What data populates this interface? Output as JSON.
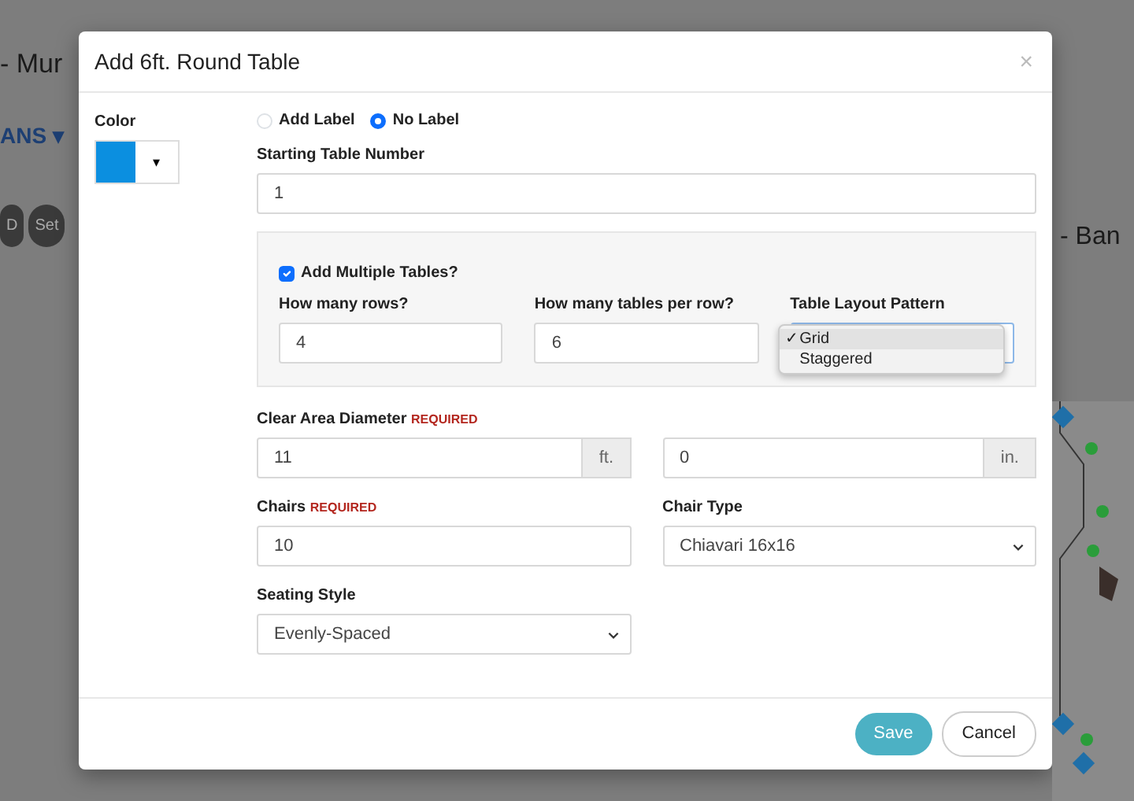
{
  "background": {
    "page_title": "- Mur",
    "menu": {
      "label": "ANS",
      "caret": "▾"
    },
    "pills": [
      "D",
      "Set"
    ],
    "heading_right": "- Ban"
  },
  "modal": {
    "title": "Add 6ft. Round Table",
    "close": "×",
    "color": {
      "label": "Color",
      "color": "#0b8fe0",
      "caret": "▾"
    },
    "label_options": [
      {
        "label": "Add Label",
        "selected": false
      },
      {
        "label": "No Label",
        "selected": true
      }
    ],
    "starting_table_number": {
      "label": "Starting Table Number",
      "value": "1"
    },
    "multiple": {
      "label": "Add Multiple Tables?",
      "checked": true,
      "rows": {
        "label": "How many rows?",
        "value": "4"
      },
      "per_row": {
        "label": "How many tables per row?",
        "value": "6"
      },
      "layout": {
        "label": "Table Layout Pattern",
        "expanded": true,
        "check_mark": "✓",
        "options": [
          {
            "label": "Grid",
            "selected": true
          },
          {
            "label": "Staggered",
            "selected": false
          }
        ]
      }
    },
    "clear_area": {
      "label": "Clear Area Diameter",
      "required": "REQUIRED",
      "feet": {
        "value": "11",
        "unit": "ft."
      },
      "inches": {
        "value": "0",
        "unit": "in."
      }
    },
    "chairs": {
      "label": "Chairs",
      "required": "REQUIRED",
      "value": "10"
    },
    "chair_type": {
      "label": "Chair Type",
      "value": "Chiavari 16x16"
    },
    "seating_style": {
      "label": "Seating Style",
      "value": "Evenly-Spaced"
    },
    "buttons": [
      {
        "label": "Save",
        "kind": "primary"
      },
      {
        "label": "Cancel",
        "kind": "secondary"
      }
    ]
  }
}
